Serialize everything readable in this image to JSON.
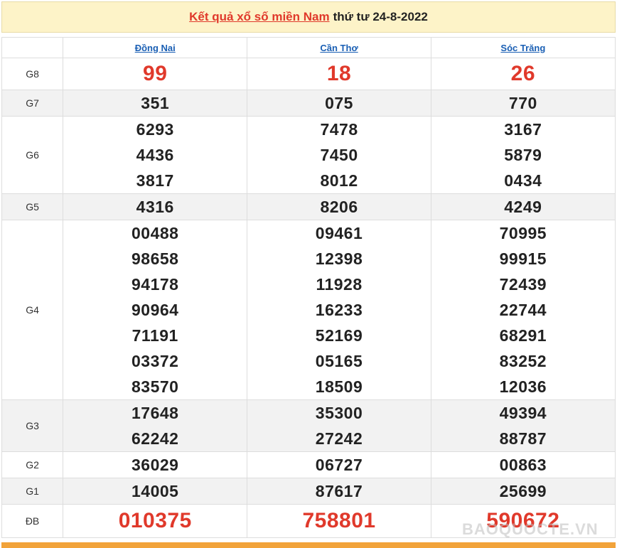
{
  "header": {
    "link_text": "Kết quả xổ số miền Nam",
    "date_text": "thứ tư 24-8-2022"
  },
  "provinces": [
    "Đồng Nai",
    "Cần Thơ",
    "Sóc Trăng"
  ],
  "prizes": {
    "g8": {
      "label": "G8",
      "values": [
        [
          "99"
        ],
        [
          "18"
        ],
        [
          "26"
        ]
      ]
    },
    "g7": {
      "label": "G7",
      "values": [
        [
          "351"
        ],
        [
          "075"
        ],
        [
          "770"
        ]
      ]
    },
    "g6": {
      "label": "G6",
      "values": [
        [
          "6293",
          "4436",
          "3817"
        ],
        [
          "7478",
          "7450",
          "8012"
        ],
        [
          "3167",
          "5879",
          "0434"
        ]
      ]
    },
    "g5": {
      "label": "G5",
      "values": [
        [
          "4316"
        ],
        [
          "8206"
        ],
        [
          "4249"
        ]
      ]
    },
    "g4": {
      "label": "G4",
      "values": [
        [
          "00488",
          "98658",
          "94178",
          "90964",
          "71191",
          "03372",
          "83570"
        ],
        [
          "09461",
          "12398",
          "11928",
          "16233",
          "52169",
          "05165",
          "18509"
        ],
        [
          "70995",
          "99915",
          "72439",
          "22744",
          "68291",
          "83252",
          "12036"
        ]
      ]
    },
    "g3": {
      "label": "G3",
      "values": [
        [
          "17648",
          "62242"
        ],
        [
          "35300",
          "27242"
        ],
        [
          "49394",
          "88787"
        ]
      ]
    },
    "g2": {
      "label": "G2",
      "values": [
        [
          "36029"
        ],
        [
          "06727"
        ],
        [
          "00863"
        ]
      ]
    },
    "g1": {
      "label": "G1",
      "values": [
        [
          "14005"
        ],
        [
          "87617"
        ],
        [
          "25699"
        ]
      ]
    },
    "db": {
      "label": "ĐB",
      "values": [
        [
          "010375"
        ],
        [
          "758801"
        ],
        [
          "590672"
        ]
      ]
    }
  },
  "watermark": "BAOQUOCTE.VN",
  "colors": {
    "accent_red": "#e0392b",
    "header_bg": "#fdf3c8",
    "link_blue": "#1a5fb4",
    "bottom_bar": "#f2a33a"
  }
}
